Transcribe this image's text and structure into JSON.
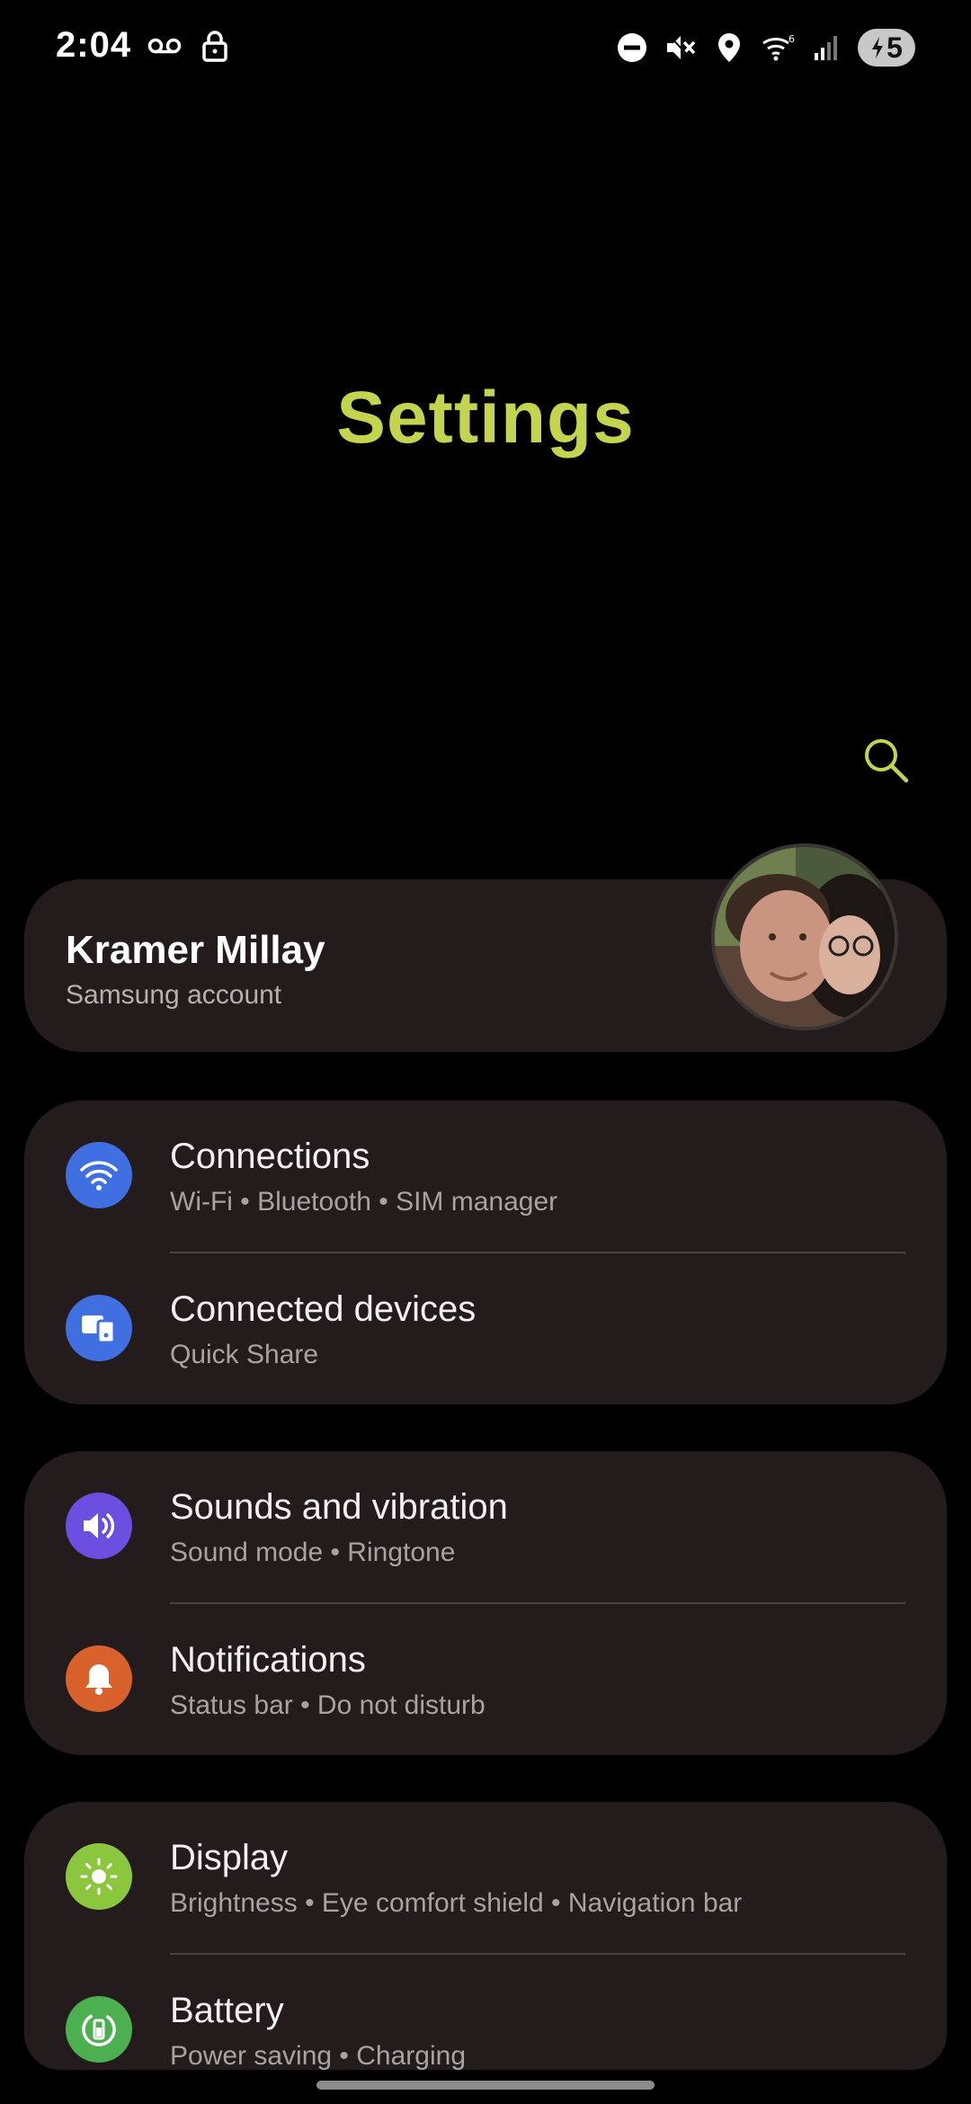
{
  "status_bar": {
    "time": "2:04",
    "battery_level": "5",
    "icons": [
      "voicemail-icon",
      "lock-icon",
      "do-not-disturb-icon",
      "mute-icon",
      "location-icon",
      "wifi-icon",
      "signal-icon",
      "battery-charging-icon"
    ]
  },
  "header": {
    "title": "Settings"
  },
  "account": {
    "name": "Kramer Millay",
    "subtitle": "Samsung account"
  },
  "groups": [
    {
      "items": [
        {
          "title": "Connections",
          "subtitle": "Wi-Fi  •  Bluetooth  •  SIM manager",
          "icon": "wifi-icon",
          "color": "#3f6fe0"
        },
        {
          "title": "Connected devices",
          "subtitle": "Quick Share",
          "icon": "devices-icon",
          "color": "#3f6fe0"
        }
      ]
    },
    {
      "items": [
        {
          "title": "Sounds and vibration",
          "subtitle": "Sound mode  •  Ringtone",
          "icon": "volume-icon",
          "color": "#6a4fe0"
        },
        {
          "title": "Notifications",
          "subtitle": "Status bar  •  Do not disturb",
          "icon": "bell-icon",
          "color": "#d9612c"
        }
      ]
    },
    {
      "items": [
        {
          "title": "Display",
          "subtitle": "Brightness  •  Eye comfort shield  •  Navigation bar",
          "icon": "sun-icon",
          "color": "#8cc63f"
        },
        {
          "title": "Battery",
          "subtitle": "Power saving  •  Charging",
          "icon": "battery-icon",
          "color": "#4caf50"
        }
      ]
    }
  ],
  "colors": {
    "accent": "#c4d44e",
    "card_background": "#241c1c",
    "background": "#000000"
  }
}
